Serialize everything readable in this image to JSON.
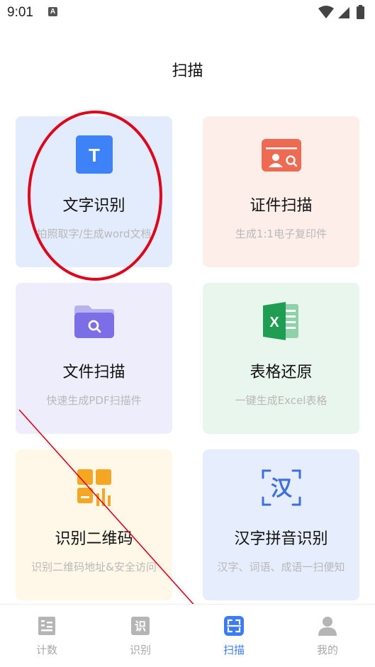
{
  "status_bar": {
    "time": "9:01",
    "notification_icon": "A"
  },
  "page": {
    "title": "扫描"
  },
  "cards": [
    {
      "id": "text-recognition",
      "title": "文字识别",
      "subtitle": "拍照取字/生成word文档",
      "icon": "text-t-icon",
      "bg": "#e3ecfc",
      "accent": "#3d82f7"
    },
    {
      "id": "id-scan",
      "title": "证件扫描",
      "subtitle": "生成1:1电子复印件",
      "icon": "id-card-icon",
      "bg": "#fdeeea",
      "accent": "#ee6a52"
    },
    {
      "id": "file-scan",
      "title": "文件扫描",
      "subtitle": "快速生成PDF扫描件",
      "icon": "folder-search-icon",
      "bg": "#eeedfb",
      "accent": "#7b6ee6"
    },
    {
      "id": "table-restore",
      "title": "表格还原",
      "subtitle": "一键生成Excel表格",
      "icon": "excel-icon",
      "bg": "#e9f6ee",
      "accent": "#1f9d53"
    },
    {
      "id": "qr-recognition",
      "title": "识别二维码",
      "subtitle": "识别二维码地址&安全访问",
      "icon": "qr-code-icon",
      "bg": "#fff7e8",
      "accent": "#f5a623"
    },
    {
      "id": "hanzi-pinyin",
      "title": "汉字拼音识别",
      "subtitle": "汉字、词语、成语一扫便知",
      "icon": "hanzi-icon",
      "bg": "#e6edfc",
      "accent": "#3d6fe0",
      "icon_char": "汉"
    }
  ],
  "tabbar": {
    "items": [
      {
        "label": "计数",
        "icon": "counter-icon"
      },
      {
        "label": "识别",
        "icon": "recognize-icon",
        "icon_char": "识"
      },
      {
        "label": "扫描",
        "icon": "scan-icon",
        "active": true
      },
      {
        "label": "我的",
        "icon": "profile-icon"
      }
    ],
    "active_color": "#3b7cf5",
    "inactive_color": "#a8a8a8"
  },
  "annotations": {
    "highlight_color": "#e0001a",
    "arrow_color": "#e0001a"
  }
}
